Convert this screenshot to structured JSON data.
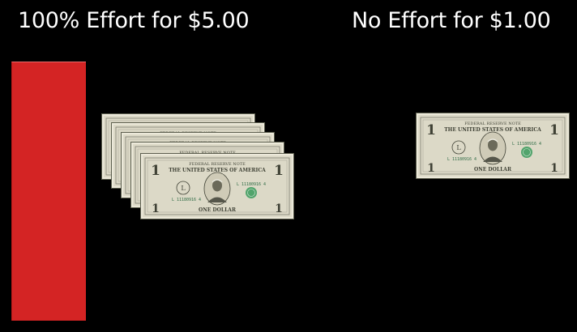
{
  "slide": {
    "background": "#000000",
    "left_option": {
      "title": "100% Effort for $5.00",
      "effort_level": 1.0,
      "effort_bar_color": "#d42424",
      "bill_count": 5
    },
    "right_option": {
      "title": "No Effort for $1.00",
      "effort_level": 0.0,
      "bill_count": 1
    }
  },
  "bill": {
    "header": "FEDERAL RESERVE NOTE",
    "country": "THE UNITED STATES OF AMERICA",
    "serial": "L 11180916 4",
    "denomination_numeral": "1",
    "denomination_words": "ONE DOLLAR",
    "seal_letter": "L",
    "icon": "one-dollar-bill-icon",
    "paper_color": "#dcd9c7",
    "ink_color": "#3f4135",
    "seal_color": "#3a9a5c"
  }
}
